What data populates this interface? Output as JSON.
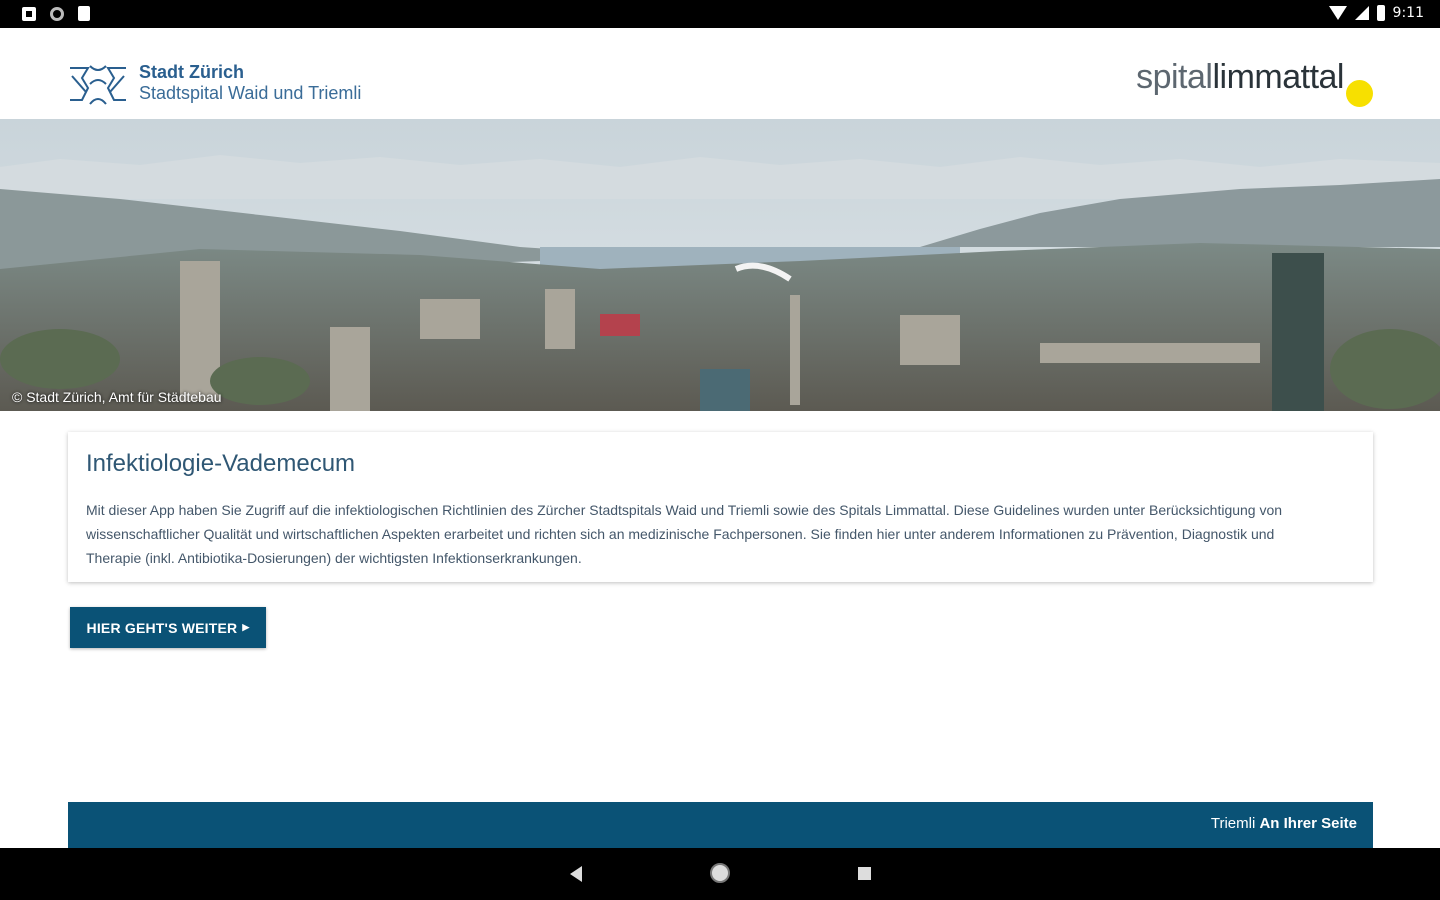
{
  "status_bar": {
    "time": "9:11",
    "left_icons": [
      "notification-icon",
      "sync-icon",
      "sd-card-icon"
    ],
    "right_icons": [
      "wifi-icon",
      "signal-icon",
      "battery-icon"
    ]
  },
  "header": {
    "city_title": "Stadt Zürich",
    "city_subtitle": "Stadtspital Waid und Triemli",
    "partner_logo_light": "spital",
    "partner_logo_bold": "limmattal",
    "partner_dot_color": "#f7e000"
  },
  "hero": {
    "credit": "© Stadt Zürich, Amt für Städtebau"
  },
  "card": {
    "title": "Infektiologie-Vademecum",
    "body": "Mit dieser App haben Sie Zugriff auf die infektiologischen Richtlinien des Zürcher Stadtspitals Waid und Triemli sowie des Spitals Limmattal. Diese Guidelines wurden unter Berücksichtigung von wissenschaftlicher Qualität und wirtschaftlichen Aspekten erarbeitet und richten sich an medizinische Fachpersonen. Sie finden hier unter anderem Informationen zu Prävention, Diagnostik und Therapie (inkl. Antibiotika-Dosierungen) der wichtigsten Infektionserkrankungen."
  },
  "cta": {
    "label": "HIER GEHT'S WEITER",
    "arrow": "▶"
  },
  "footer": {
    "light": "Triemli",
    "bold": "An Ihrer Seite"
  },
  "colors": {
    "primary": "#0a5276",
    "brand_blue": "#2a5f8f",
    "accent_yellow": "#f7e000"
  }
}
